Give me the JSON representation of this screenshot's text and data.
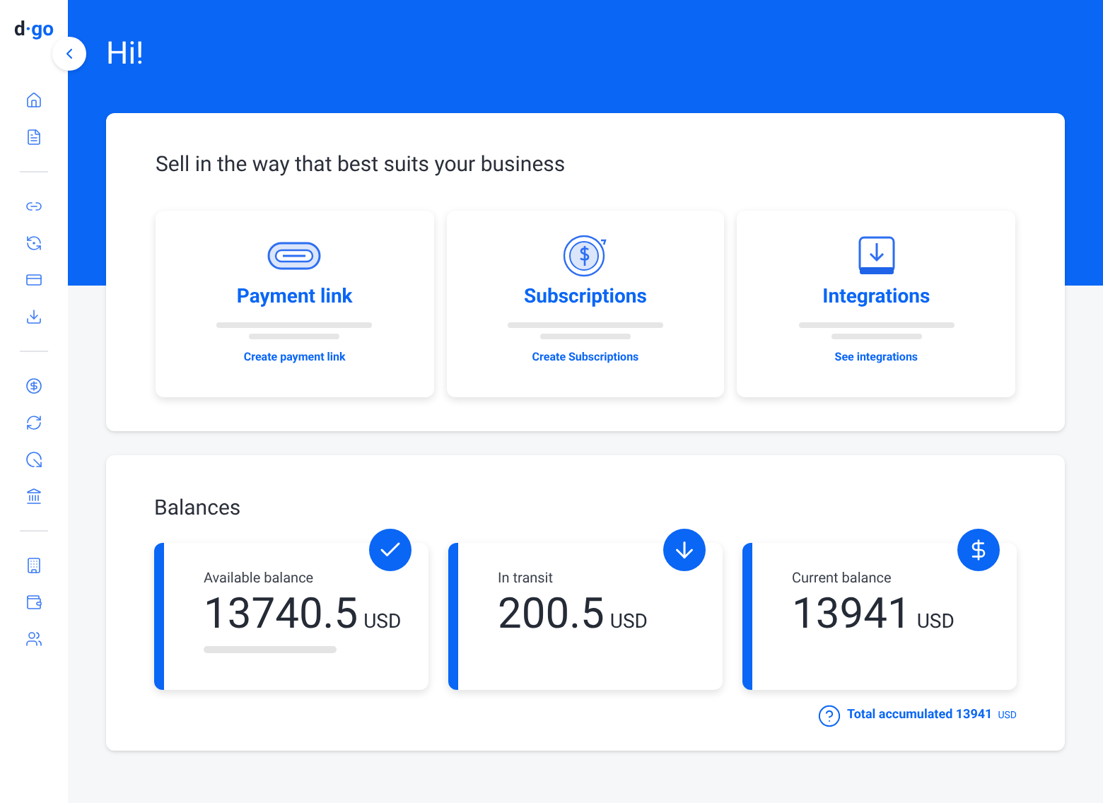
{
  "logo": {
    "dark": "d",
    "accent": "·go"
  },
  "header": {
    "title": "Hi!"
  },
  "sell": {
    "title": "Sell in the way that best suits your business",
    "cards": [
      {
        "kind": "link",
        "title": "Payment link",
        "action": "Create payment link"
      },
      {
        "kind": "subscription",
        "title": "Subscriptions",
        "action": "Create Subscriptions"
      },
      {
        "kind": "integration",
        "title": "Integrations",
        "action": "See integrations"
      }
    ]
  },
  "balances": {
    "title": "Balances",
    "cards": [
      {
        "kind": "check",
        "label": "Available balance",
        "amount": "13740.5",
        "currency": "USD",
        "bar": true
      },
      {
        "kind": "transit",
        "label": "In transit",
        "amount": "200.5",
        "currency": "USD",
        "bar": false
      },
      {
        "kind": "dollar",
        "label": "Current balance",
        "amount": "13941",
        "currency": "USD",
        "bar": false
      }
    ],
    "total": {
      "label": "Total accumulated 13941",
      "currency": "USD"
    }
  }
}
